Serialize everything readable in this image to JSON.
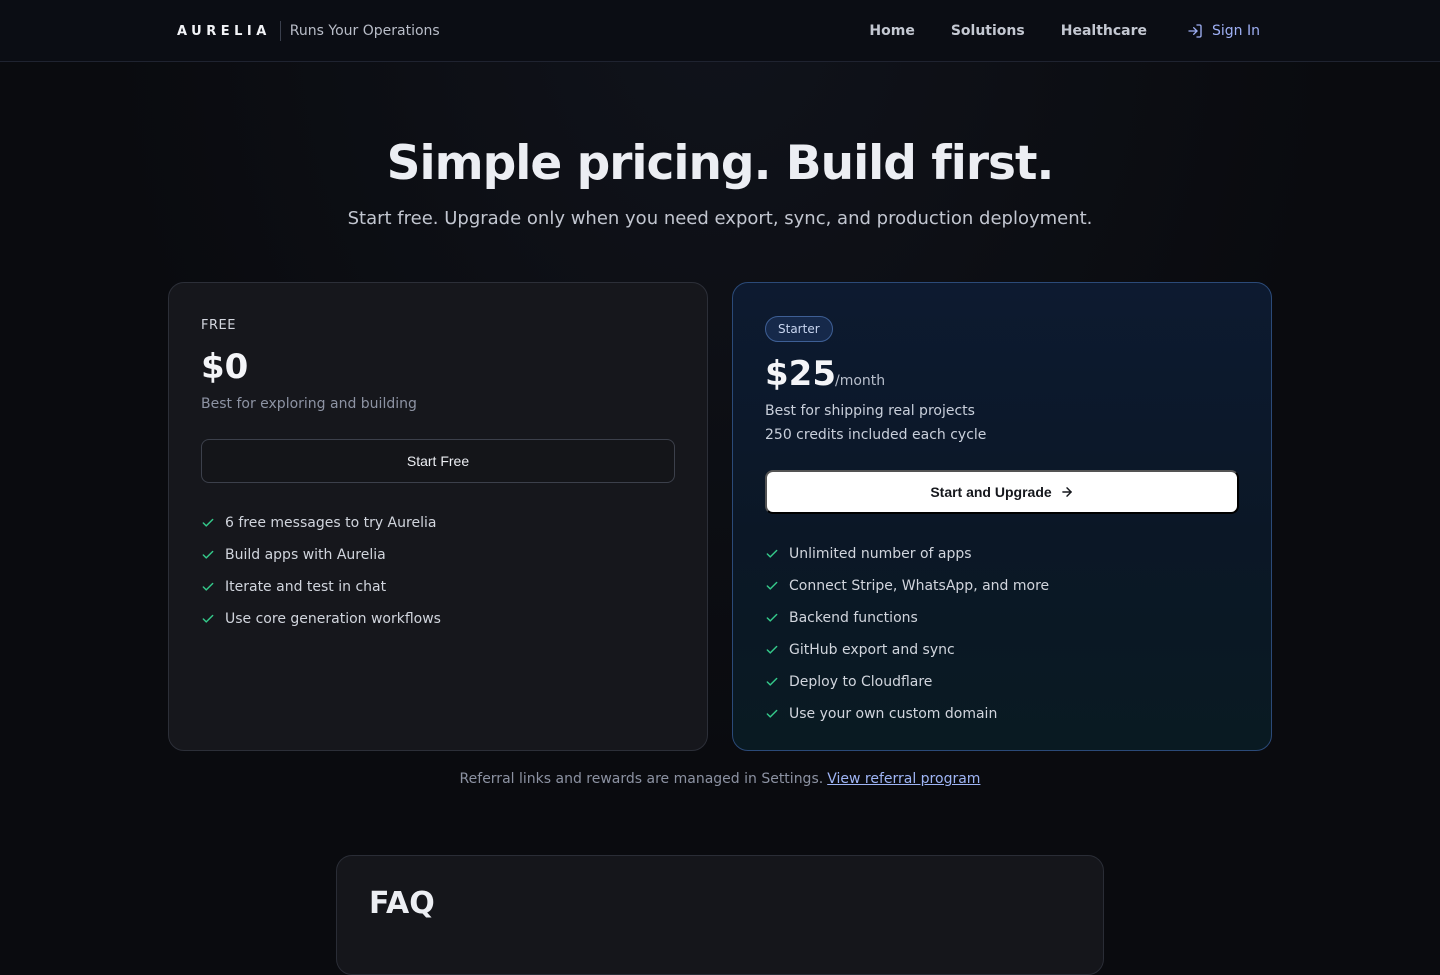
{
  "header": {
    "brand": "AURELIA",
    "tagline": "Runs Your Operations",
    "nav": [
      "Home",
      "Solutions",
      "Healthcare"
    ],
    "sign_in": "Sign In"
  },
  "hero": {
    "title": "Simple pricing. Build first.",
    "subtitle": "Start free. Upgrade only when you need export, sync, and production deployment."
  },
  "plans": {
    "free": {
      "label": "FREE",
      "price": "$0",
      "description": "Best for exploring and building",
      "button": "Start Free",
      "features": [
        "6 free messages to try Aurelia",
        "Build apps with Aurelia",
        "Iterate and test in chat",
        "Use core generation workflows"
      ]
    },
    "starter": {
      "badge": "Starter",
      "price": "$25",
      "period": "/month",
      "description": "Best for shipping real projects",
      "credits": "250 credits included each cycle",
      "button": "Start and Upgrade",
      "features": [
        "Unlimited number of apps",
        "Connect Stripe, WhatsApp, and more",
        "Backend functions",
        "GitHub export and sync",
        "Deploy to Cloudflare",
        "Use your own custom domain"
      ]
    }
  },
  "referral": {
    "text": "Referral links and rewards are managed in Settings.",
    "link": "View referral program"
  },
  "faq": {
    "title": "FAQ"
  },
  "colors": {
    "background": "#0a0b0f",
    "check": "#34c98a",
    "accent_link": "#9fb5f5",
    "starter_border": "#2b4a78"
  },
  "icons": {
    "sign_in": "sign-in-icon",
    "check": "check-icon",
    "arrow": "arrow-right-icon"
  }
}
